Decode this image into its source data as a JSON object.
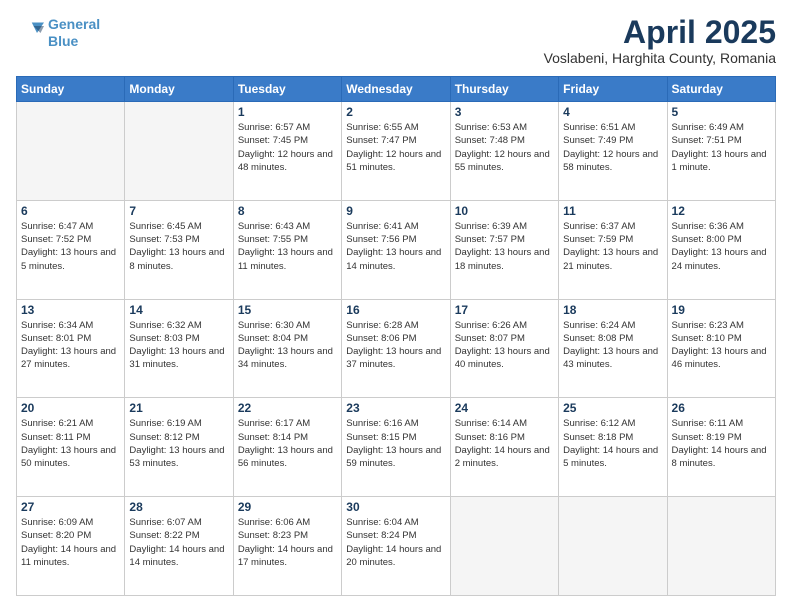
{
  "header": {
    "logo_line1": "General",
    "logo_line2": "Blue",
    "month": "April 2025",
    "location": "Voslabeni, Harghita County, Romania"
  },
  "days_of_week": [
    "Sunday",
    "Monday",
    "Tuesday",
    "Wednesday",
    "Thursday",
    "Friday",
    "Saturday"
  ],
  "weeks": [
    [
      {
        "day": "",
        "info": ""
      },
      {
        "day": "",
        "info": ""
      },
      {
        "day": "1",
        "info": "Sunrise: 6:57 AM\nSunset: 7:45 PM\nDaylight: 12 hours and 48 minutes."
      },
      {
        "day": "2",
        "info": "Sunrise: 6:55 AM\nSunset: 7:47 PM\nDaylight: 12 hours and 51 minutes."
      },
      {
        "day": "3",
        "info": "Sunrise: 6:53 AM\nSunset: 7:48 PM\nDaylight: 12 hours and 55 minutes."
      },
      {
        "day": "4",
        "info": "Sunrise: 6:51 AM\nSunset: 7:49 PM\nDaylight: 12 hours and 58 minutes."
      },
      {
        "day": "5",
        "info": "Sunrise: 6:49 AM\nSunset: 7:51 PM\nDaylight: 13 hours and 1 minute."
      }
    ],
    [
      {
        "day": "6",
        "info": "Sunrise: 6:47 AM\nSunset: 7:52 PM\nDaylight: 13 hours and 5 minutes."
      },
      {
        "day": "7",
        "info": "Sunrise: 6:45 AM\nSunset: 7:53 PM\nDaylight: 13 hours and 8 minutes."
      },
      {
        "day": "8",
        "info": "Sunrise: 6:43 AM\nSunset: 7:55 PM\nDaylight: 13 hours and 11 minutes."
      },
      {
        "day": "9",
        "info": "Sunrise: 6:41 AM\nSunset: 7:56 PM\nDaylight: 13 hours and 14 minutes."
      },
      {
        "day": "10",
        "info": "Sunrise: 6:39 AM\nSunset: 7:57 PM\nDaylight: 13 hours and 18 minutes."
      },
      {
        "day": "11",
        "info": "Sunrise: 6:37 AM\nSunset: 7:59 PM\nDaylight: 13 hours and 21 minutes."
      },
      {
        "day": "12",
        "info": "Sunrise: 6:36 AM\nSunset: 8:00 PM\nDaylight: 13 hours and 24 minutes."
      }
    ],
    [
      {
        "day": "13",
        "info": "Sunrise: 6:34 AM\nSunset: 8:01 PM\nDaylight: 13 hours and 27 minutes."
      },
      {
        "day": "14",
        "info": "Sunrise: 6:32 AM\nSunset: 8:03 PM\nDaylight: 13 hours and 31 minutes."
      },
      {
        "day": "15",
        "info": "Sunrise: 6:30 AM\nSunset: 8:04 PM\nDaylight: 13 hours and 34 minutes."
      },
      {
        "day": "16",
        "info": "Sunrise: 6:28 AM\nSunset: 8:06 PM\nDaylight: 13 hours and 37 minutes."
      },
      {
        "day": "17",
        "info": "Sunrise: 6:26 AM\nSunset: 8:07 PM\nDaylight: 13 hours and 40 minutes."
      },
      {
        "day": "18",
        "info": "Sunrise: 6:24 AM\nSunset: 8:08 PM\nDaylight: 13 hours and 43 minutes."
      },
      {
        "day": "19",
        "info": "Sunrise: 6:23 AM\nSunset: 8:10 PM\nDaylight: 13 hours and 46 minutes."
      }
    ],
    [
      {
        "day": "20",
        "info": "Sunrise: 6:21 AM\nSunset: 8:11 PM\nDaylight: 13 hours and 50 minutes."
      },
      {
        "day": "21",
        "info": "Sunrise: 6:19 AM\nSunset: 8:12 PM\nDaylight: 13 hours and 53 minutes."
      },
      {
        "day": "22",
        "info": "Sunrise: 6:17 AM\nSunset: 8:14 PM\nDaylight: 13 hours and 56 minutes."
      },
      {
        "day": "23",
        "info": "Sunrise: 6:16 AM\nSunset: 8:15 PM\nDaylight: 13 hours and 59 minutes."
      },
      {
        "day": "24",
        "info": "Sunrise: 6:14 AM\nSunset: 8:16 PM\nDaylight: 14 hours and 2 minutes."
      },
      {
        "day": "25",
        "info": "Sunrise: 6:12 AM\nSunset: 8:18 PM\nDaylight: 14 hours and 5 minutes."
      },
      {
        "day": "26",
        "info": "Sunrise: 6:11 AM\nSunset: 8:19 PM\nDaylight: 14 hours and 8 minutes."
      }
    ],
    [
      {
        "day": "27",
        "info": "Sunrise: 6:09 AM\nSunset: 8:20 PM\nDaylight: 14 hours and 11 minutes."
      },
      {
        "day": "28",
        "info": "Sunrise: 6:07 AM\nSunset: 8:22 PM\nDaylight: 14 hours and 14 minutes."
      },
      {
        "day": "29",
        "info": "Sunrise: 6:06 AM\nSunset: 8:23 PM\nDaylight: 14 hours and 17 minutes."
      },
      {
        "day": "30",
        "info": "Sunrise: 6:04 AM\nSunset: 8:24 PM\nDaylight: 14 hours and 20 minutes."
      },
      {
        "day": "",
        "info": ""
      },
      {
        "day": "",
        "info": ""
      },
      {
        "day": "",
        "info": ""
      }
    ]
  ]
}
